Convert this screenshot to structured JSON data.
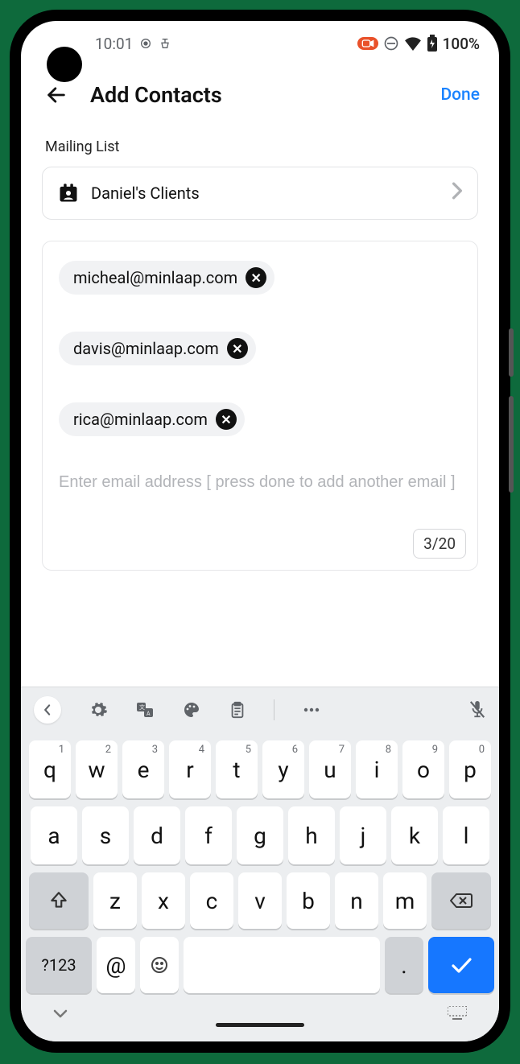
{
  "status": {
    "time": "10:01",
    "battery_text": "100%"
  },
  "header": {
    "title": "Add Contacts",
    "done_label": "Done"
  },
  "section_label": "Mailing List",
  "mailing_list": {
    "name": "Daniel's Clients"
  },
  "contacts": [
    "micheal@minlaap.com",
    "davis@minlaap.com",
    "rica@minlaap.com"
  ],
  "input_placeholder": "Enter email address [ press done to add another email ]",
  "counter": "3/20",
  "keyboard": {
    "row1": [
      "q",
      "w",
      "e",
      "r",
      "t",
      "y",
      "u",
      "i",
      "o",
      "p"
    ],
    "row1_sup": [
      "1",
      "2",
      "3",
      "4",
      "5",
      "6",
      "7",
      "8",
      "9",
      "0"
    ],
    "row2": [
      "a",
      "s",
      "d",
      "f",
      "g",
      "h",
      "j",
      "k",
      "l"
    ],
    "row3": [
      "z",
      "x",
      "c",
      "v",
      "b",
      "n",
      "m"
    ],
    "sym_label": "?123",
    "at_label": "@",
    "period_label": "."
  }
}
